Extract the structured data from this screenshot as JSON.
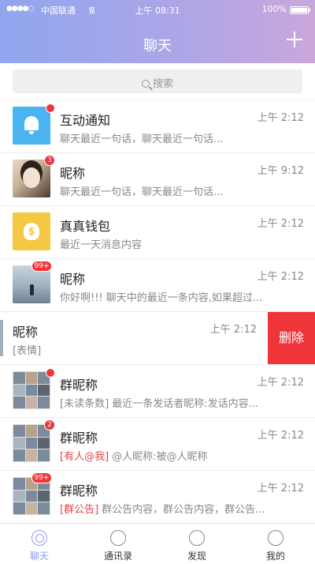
{
  "statusbar": {
    "signal": "●●●●○",
    "carrier": "中国联通",
    "wifi": "wifi-icon",
    "time": "上午 08:31",
    "battery": "100%"
  },
  "nav": {
    "title": "聊天",
    "add_icon": "plus-icon"
  },
  "search": {
    "placeholder": "搜索"
  },
  "conversations": [
    {
      "name": "互动通知",
      "time": "上午 2:12",
      "preview": "聊天最近一句话，聊天最近一句话...",
      "avatar": "bell-icon",
      "unread": "dot"
    },
    {
      "name": "昵称",
      "time": "上午 9:12",
      "preview": "聊天最近一句话，聊天最近一句话...",
      "avatar": "person-photo",
      "unread": "3"
    },
    {
      "name": "真真钱包",
      "time": "上午 2:12",
      "preview": "最近一天消息内容",
      "avatar": "money-bag-icon",
      "unread": ""
    },
    {
      "name": "昵称",
      "time": "上午 2:12",
      "preview": "你好啊!!! 聊天中的最近一条内容,如果超过...",
      "avatar": "beach-photo",
      "unread": "99+"
    },
    {
      "name": "昵称",
      "time": "上午 2:12",
      "preview": "[表情]",
      "avatar": "beach-photo",
      "unread": "",
      "action": "删除"
    },
    {
      "name": "群昵称",
      "time": "上午 2:12",
      "tag": "",
      "preview": "[未读条数] 最近一条发话者昵称:发话内容...",
      "avatar": "group-grid",
      "unread": "dot"
    },
    {
      "name": "群昵称",
      "time": "上午 2:12",
      "tag": "[有人@我]",
      "preview": "@人昵称:被@人昵称",
      "avatar": "group-grid",
      "unread": "2"
    },
    {
      "name": "群昵称",
      "time": "上午 2:12",
      "tag": "[群公告]",
      "preview": "群公告内容，群公告内容，群公告...",
      "avatar": "group-grid",
      "unread": "99+"
    }
  ],
  "tabs": [
    {
      "label": "聊天",
      "icon": "chat-icon",
      "active": true
    },
    {
      "label": "通讯录",
      "icon": "contacts-icon",
      "active": false
    },
    {
      "label": "发现",
      "icon": "compass-icon",
      "active": false
    },
    {
      "label": "我的",
      "icon": "profile-icon",
      "active": false
    }
  ],
  "colors": {
    "accent": "#8c9df0",
    "badge": "#f0353a",
    "delete": "#f0353a"
  }
}
